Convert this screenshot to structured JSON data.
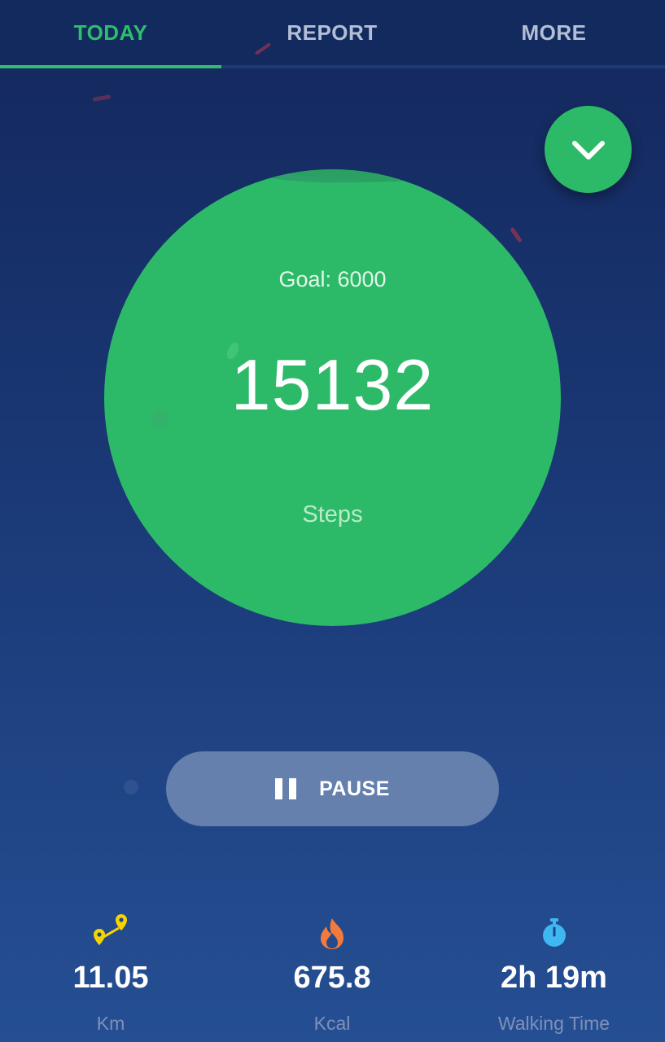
{
  "tabs": [
    {
      "label": "TODAY",
      "active": true
    },
    {
      "label": "REPORT",
      "active": false
    },
    {
      "label": "MORE",
      "active": false
    }
  ],
  "colors": {
    "accent": "#2fbe6b",
    "background_top": "#13275c",
    "background_bottom": "#254f93",
    "pause_button": "#6580ad"
  },
  "collapse_button": {
    "icon": "chevron-down-icon"
  },
  "progress": {
    "goal_label": "Goal: 6000",
    "steps": "15132",
    "unit": "Steps"
  },
  "pause_button": {
    "icon": "pause-icon",
    "label": "PAUSE"
  },
  "stats": [
    {
      "icon": "route-pin-icon",
      "value": "11.05",
      "unit": "Km"
    },
    {
      "icon": "flame-icon",
      "value": "675.8",
      "unit": "Kcal"
    },
    {
      "icon": "stopwatch-icon",
      "value": "2h 19m",
      "unit": "Walking Time"
    }
  ]
}
